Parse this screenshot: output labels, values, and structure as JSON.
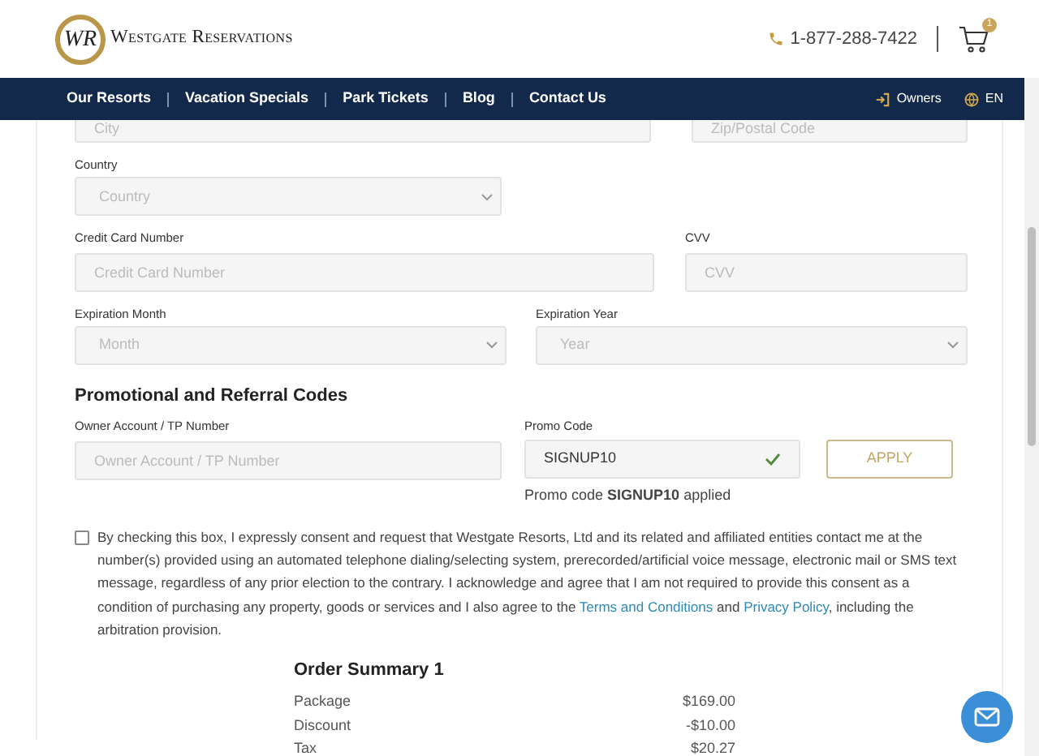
{
  "header": {
    "logo_monogram": "WR",
    "brand": "Westgate Reservations",
    "phone": "1-877-288-7422",
    "cart_count": "1"
  },
  "nav": {
    "items": [
      {
        "label": "Our Resorts"
      },
      {
        "label": "Vacation Specials"
      },
      {
        "label": "Park Tickets"
      },
      {
        "label": "Blog"
      },
      {
        "label": "Contact Us"
      }
    ],
    "owners": "Owners",
    "language": "EN"
  },
  "address_row": [
    {
      "placeholder": "City"
    },
    {
      "placeholder": "Zip/Postal Code"
    }
  ],
  "country": {
    "label": "Country",
    "placeholder": "Country"
  },
  "card_row": [
    {
      "label": "Credit Card Number",
      "placeholder": "Credit Card Number"
    },
    {
      "label": "CVV",
      "placeholder": "CVV"
    }
  ],
  "expiry_row": [
    {
      "label": "Expiration Month",
      "placeholder": "Month"
    },
    {
      "label": "Expiration Year",
      "placeholder": "Year"
    }
  ],
  "promotions": {
    "title": "Promotional and Referral Codes",
    "owner_label": "Owner Account / TP Number",
    "owner_placeholder": "Owner Account / TP Number",
    "promo_label": "Promo Code",
    "promo_value": "SIGNUP10",
    "promo_valid": true,
    "apply": "APPLY",
    "applied_message": "Promo code **SIGNUP10** applied"
  },
  "consent": {
    "checked": false,
    "text": "By checking this box, I expressly consent and request that Westgate Resorts, Ltd and its related and affiliated entities contact me at the number(s) provided using an automated telephone dialing/selecting system, prerecorded/artificial voice message, electronic mail or SMS text message, regardless of any prior election to the contrary. I acknowledge and agree that I am not required to provide this consent as a condition of purchasing any property, goods or services and I also agree to the",
    "terms_link": "Terms and Conditions",
    "and": "and",
    "privacy_link": "Privacy Policy",
    "tail": ", including the arbitration provision."
  },
  "order_summary": {
    "title": "Order Summary 1",
    "rows": [
      {
        "label": "Package",
        "amount": "$169.00"
      },
      {
        "label": "Discount",
        "amount": "-$10.00"
      },
      {
        "label": "Tax",
        "amount": "$20.27"
      }
    ]
  }
}
